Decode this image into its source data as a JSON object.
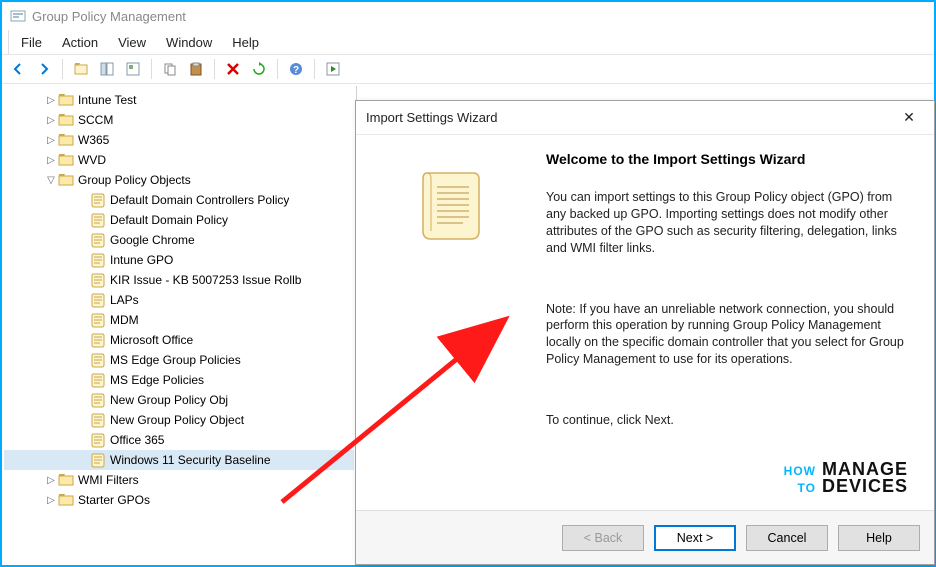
{
  "window": {
    "title": "Group Policy Management"
  },
  "menu": {
    "file": "File",
    "action": "Action",
    "view": "View",
    "window": "Window",
    "help": "Help"
  },
  "tree": {
    "items": [
      {
        "indent": 40,
        "exp": "▷",
        "type": "folder",
        "label": "Intune Test"
      },
      {
        "indent": 40,
        "exp": "▷",
        "type": "folder",
        "label": "SCCM"
      },
      {
        "indent": 40,
        "exp": "▷",
        "type": "folder",
        "label": "W365"
      },
      {
        "indent": 40,
        "exp": "▷",
        "type": "folder",
        "label": "WVD"
      },
      {
        "indent": 40,
        "exp": "▽",
        "type": "folder-open",
        "label": "Group Policy Objects"
      },
      {
        "indent": 72,
        "exp": "",
        "type": "gpo",
        "label": "Default Domain Controllers Policy"
      },
      {
        "indent": 72,
        "exp": "",
        "type": "gpo",
        "label": "Default Domain Policy"
      },
      {
        "indent": 72,
        "exp": "",
        "type": "gpo",
        "label": "Google Chrome"
      },
      {
        "indent": 72,
        "exp": "",
        "type": "gpo",
        "label": "Intune GPO"
      },
      {
        "indent": 72,
        "exp": "",
        "type": "gpo",
        "label": "KIR Issue - KB 5007253 Issue Rollb"
      },
      {
        "indent": 72,
        "exp": "",
        "type": "gpo",
        "label": "LAPs"
      },
      {
        "indent": 72,
        "exp": "",
        "type": "gpo",
        "label": "MDM"
      },
      {
        "indent": 72,
        "exp": "",
        "type": "gpo",
        "label": "Microsoft Office"
      },
      {
        "indent": 72,
        "exp": "",
        "type": "gpo",
        "label": "MS Edge Group Policies"
      },
      {
        "indent": 72,
        "exp": "",
        "type": "gpo",
        "label": "MS Edge Policies"
      },
      {
        "indent": 72,
        "exp": "",
        "type": "gpo",
        "label": "New Group Policy Obj"
      },
      {
        "indent": 72,
        "exp": "",
        "type": "gpo",
        "label": "New Group Policy Object"
      },
      {
        "indent": 72,
        "exp": "",
        "type": "gpo",
        "label": "Office 365"
      },
      {
        "indent": 72,
        "exp": "",
        "type": "gpo",
        "label": "Windows 11 Security Baseline",
        "selected": true
      },
      {
        "indent": 40,
        "exp": "▷",
        "type": "folder",
        "label": "WMI Filters"
      },
      {
        "indent": 40,
        "exp": "▷",
        "type": "folder",
        "label": "Starter GPOs"
      }
    ]
  },
  "wizard": {
    "title": "Import Settings Wizard",
    "heading": "Welcome to the Import Settings Wizard",
    "para1": "You can import settings to this Group Policy object (GPO) from any backed up GPO. Importing settings does not modify other attributes of the GPO such as security filtering, delegation, links and WMI filter links.",
    "para2": "Note: If you have an unreliable network connection, you should perform this operation by running Group Policy Management locally on the specific domain controller that you select for Group Policy Management to use for its operations.",
    "para3": "To continue, click Next.",
    "buttons": {
      "back": "< Back",
      "next": "Next >",
      "cancel": "Cancel",
      "help": "Help"
    }
  },
  "watermark": {
    "line1_a": "HOW",
    "line1_b": "MANAGE",
    "line2_a": "TO",
    "line2_b": "DEVICES"
  }
}
